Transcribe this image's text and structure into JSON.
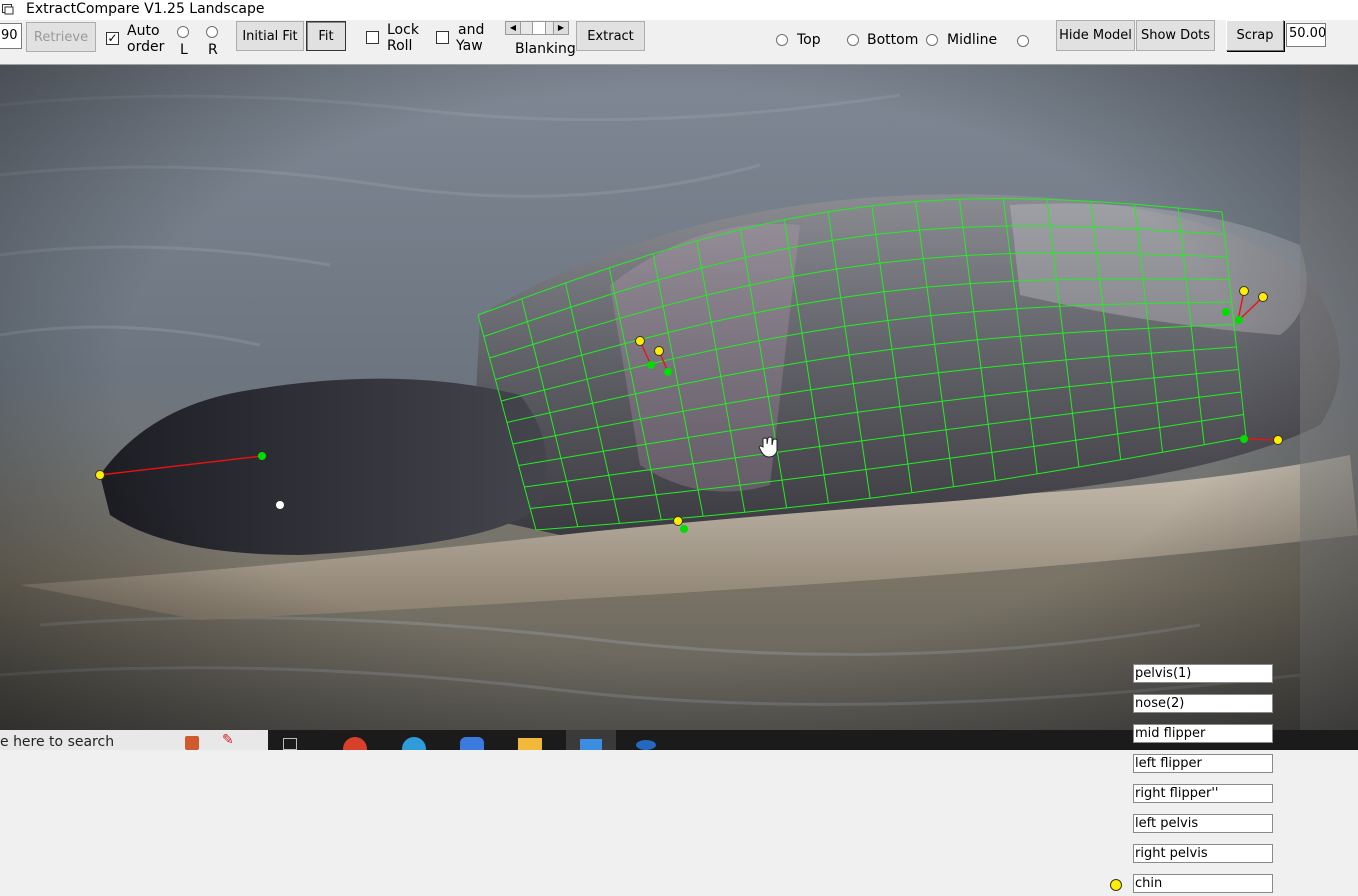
{
  "window": {
    "title": "ExtractCompare V1.25 Landscape"
  },
  "toolbar": {
    "left_value": "90",
    "retrieve_label": "Retrieve",
    "auto_order_label_1": "Auto",
    "auto_order_label_2": "order",
    "radio_l_label": "L",
    "radio_r_label": "R",
    "initial_fit_label": "Initial Fit",
    "fit_label": "Fit",
    "lock_roll_label_1": "Lock",
    "lock_roll_label_2": "Roll",
    "and_yaw_label_1": "and",
    "and_yaw_label_2": "Yaw",
    "blanking_label": "Blanking",
    "extract_label": "Extract",
    "top_label": "Top",
    "bottom_label": "Bottom",
    "midline_label": "Midline",
    "hide_model_label": "Hide Model",
    "show_dots_label": "Show Dots",
    "scrap_label": "Scrap",
    "scrap_value": "50.00",
    "auto_order_checked": true,
    "lock_roll_checked": false,
    "and_yaw_checked": false
  },
  "taskbar": {
    "search_text": "e here to search"
  },
  "point_fields": [
    {
      "label": "pelvis(1)",
      "active": false
    },
    {
      "label": "nose(2)",
      "active": false
    },
    {
      "label": "mid flipper",
      "active": false
    },
    {
      "label": "left flipper",
      "active": false
    },
    {
      "label": "right flipper''",
      "active": false
    },
    {
      "label": "left pelvis",
      "active": false
    },
    {
      "label": "right pelvis",
      "active": false
    },
    {
      "label": "chin",
      "active": true
    }
  ],
  "colors": {
    "mesh": "#22ee22",
    "marker_yellow": "#ffee00",
    "marker_green": "#00dd00",
    "link_red": "#ee1111"
  }
}
